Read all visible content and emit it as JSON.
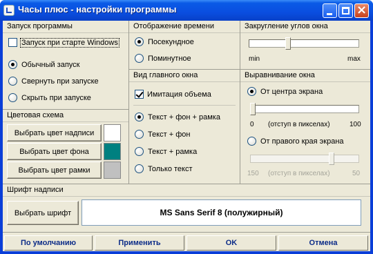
{
  "window": {
    "title": "Часы плюс - настройки программы",
    "controls": {
      "minimize_icon": "minimize-icon",
      "maximize_icon": "maximize-icon",
      "close_icon": "close-icon",
      "close_glyph": "×"
    }
  },
  "startup": {
    "header": "Запуск программы",
    "autostart_label": "Запуск при старте Windows",
    "autostart_checked": false,
    "options": [
      {
        "label": "Обычный запуск",
        "selected": true
      },
      {
        "label": "Свернуть при запуске",
        "selected": false
      },
      {
        "label": "Скрыть при запуске",
        "selected": false
      }
    ]
  },
  "color_scheme": {
    "header": "Цветовая схема",
    "buttons": [
      {
        "label": "Выбрать цвет надписи",
        "color": "#ffffff"
      },
      {
        "label": "Выбрать цвет фона",
        "color": "#008080"
      },
      {
        "label": "Выбрать цвет рамки",
        "color": "#c0c0c0"
      }
    ]
  },
  "time_display": {
    "header": "Отображение времени",
    "options": [
      {
        "label": "Посекундное",
        "selected": true
      },
      {
        "label": "Поминутное",
        "selected": false
      }
    ]
  },
  "main_view": {
    "header": "Вид главного окна",
    "volume_label": "Имитация объема",
    "volume_checked": true,
    "options": [
      {
        "label": "Текст + фон + рамка",
        "selected": true
      },
      {
        "label": "Текст + фон",
        "selected": false
      },
      {
        "label": "Текст + рамка",
        "selected": false
      },
      {
        "label": "Только текст",
        "selected": false
      }
    ]
  },
  "corner_rounding": {
    "header": "Закругление углов окна",
    "min_label": "min",
    "max_label": "max",
    "slider_value": 0.35
  },
  "alignment": {
    "header": "Выравнивание окна",
    "center_label": "От центра экрана",
    "center_selected": true,
    "center_slider": {
      "min": "0",
      "unit": "(отступ в пикселах)",
      "max": "100",
      "value": 0
    },
    "right_label": "От правого края экрана",
    "right_selected": false,
    "right_slider": {
      "min": "150",
      "unit": "(отступ в пикселах)",
      "max": "50",
      "value": 0.76,
      "disabled": true
    }
  },
  "font": {
    "header": "Шрифт надписи",
    "button_label": "Выбрать шрифт",
    "current_font": "MS Sans Serif 8 (полужирный)"
  },
  "footer": {
    "default": "По умолчанию",
    "apply": "Применить",
    "ok": "OK",
    "cancel": "Отмена"
  }
}
